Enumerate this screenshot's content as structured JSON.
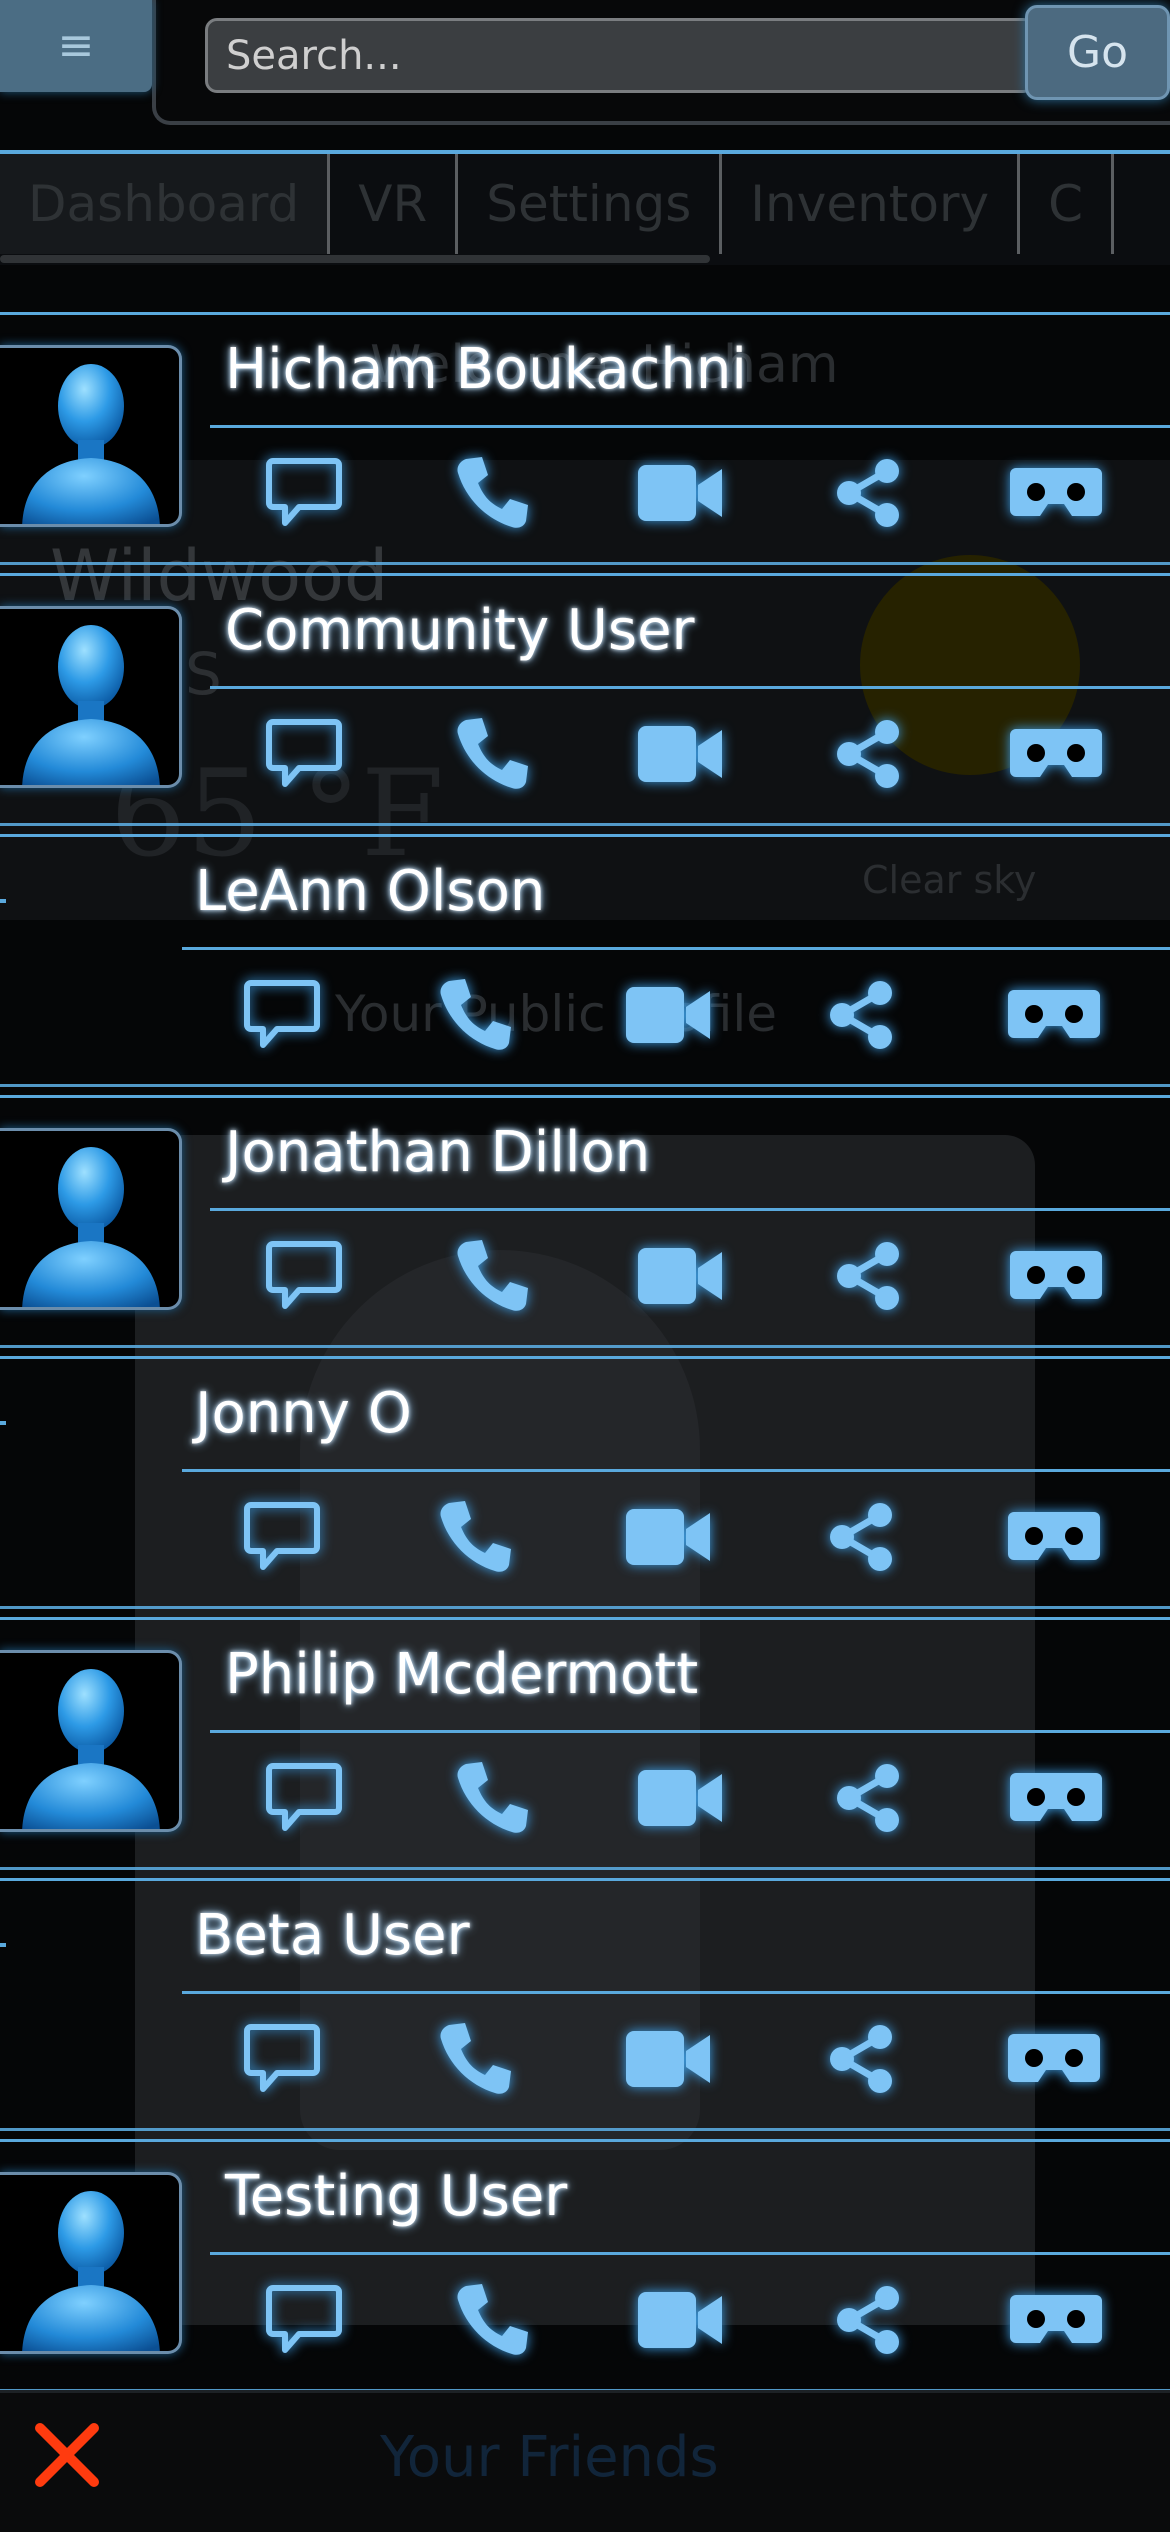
{
  "header": {
    "menu_icon": "hamburger-icon",
    "search_placeholder": "Search...",
    "go_label": "Go"
  },
  "tabs": [
    {
      "label": "Dashboard",
      "active": true
    },
    {
      "label": "VR",
      "active": false
    },
    {
      "label": "Settings",
      "active": false
    },
    {
      "label": "Inventory",
      "active": false
    },
    {
      "label": "C",
      "active": false
    }
  ],
  "background": {
    "welcome": "Welcome, Hicham",
    "city": "Wildwood",
    "region": "FL, US",
    "temperature": "65 °F",
    "sky": "Clear sky",
    "public_profile": "Your Public Profile",
    "panel_title": "Your Friends"
  },
  "friends": [
    {
      "name": "Hicham Boukachni",
      "has_avatar": true
    },
    {
      "name": "Community User",
      "has_avatar": true
    },
    {
      "name": "LeAnn Olson",
      "has_avatar": false
    },
    {
      "name": "Jonathan Dillon",
      "has_avatar": true
    },
    {
      "name": "Jonny O",
      "has_avatar": false
    },
    {
      "name": "Philip Mcdermott",
      "has_avatar": true
    },
    {
      "name": "Beta User",
      "has_avatar": false
    },
    {
      "name": "Testing User",
      "has_avatar": true
    }
  ],
  "friend_actions": [
    "chat-icon",
    "phone-icon",
    "video-icon",
    "share-icon",
    "vr-headset-icon"
  ],
  "colors": {
    "accent": "#5aa9dd",
    "icon": "#7ec4f5",
    "close": "#ff3b0f"
  },
  "footer": {
    "close_icon": "close-x-icon"
  }
}
